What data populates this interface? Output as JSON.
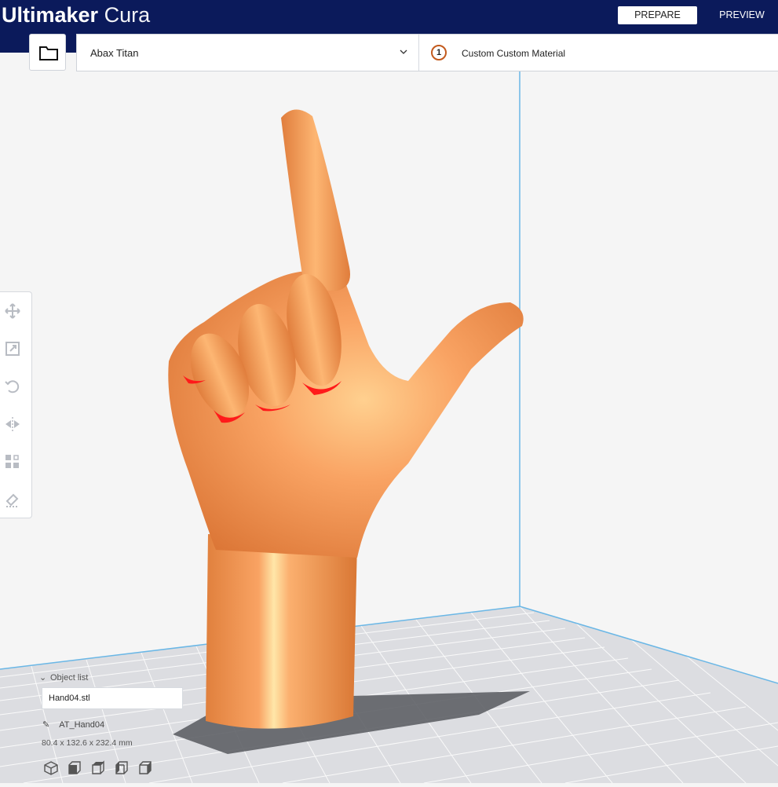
{
  "app": {
    "brand_bold": "Ultimaker",
    "brand_light": "Cura"
  },
  "stages": {
    "prepare": "PREPARE",
    "preview": "PREVIEW"
  },
  "machine": {
    "name": "Abax Titan",
    "extruder_number": "1",
    "material": "Custom Custom Material"
  },
  "toolbar": {
    "tools": [
      "move-icon",
      "scale-icon",
      "rotate-icon",
      "mirror-icon",
      "per-model-settings-icon",
      "support-blocker-icon"
    ]
  },
  "object_list": {
    "toggle_label": "Object list",
    "file": "Hand04.stl",
    "object_name": "AT_Hand04",
    "dimensions": "80.4 x 132.6 x 232.4 mm"
  },
  "view_buttons": [
    "3d-view-icon",
    "front-view-icon",
    "top-view-icon",
    "left-view-icon",
    "right-view-icon"
  ],
  "colors": {
    "header": "#0b1a5b",
    "model": "#f7a063",
    "overhang": "#ff0000"
  }
}
